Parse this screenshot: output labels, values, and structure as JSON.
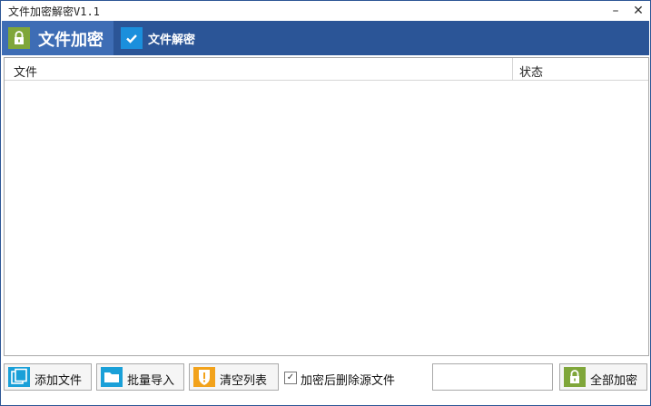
{
  "window": {
    "title": "文件加密解密V1.1",
    "minimize": "–",
    "close": "✕"
  },
  "tabs": {
    "encrypt_label": "文件加密",
    "decrypt_label": "文件解密"
  },
  "table": {
    "columns": [
      "文件",
      "状态"
    ],
    "rows": []
  },
  "toolbar": {
    "add_file": "添加文件",
    "batch_import": "批量导入",
    "clear_list": "清空列表",
    "delete_source_label": "加密后删除源文件",
    "delete_source_checked": "✓",
    "password_value": "",
    "encrypt_all": "全部加密"
  },
  "colors": {
    "tabbar": "#2b5597",
    "active_tab": "#3e6db5",
    "lock_green": "#7fa63a",
    "check_blue": "#1b8fdc",
    "folder_cyan": "#1aa0d8",
    "warn_orange": "#f2a21b"
  },
  "icons": {
    "encrypt_tab": "lock-icon",
    "decrypt_tab": "check-icon",
    "add_file": "files-icon",
    "batch_import": "folder-icon",
    "clear_list": "warning-shield-icon",
    "encrypt_all": "lock-icon"
  }
}
